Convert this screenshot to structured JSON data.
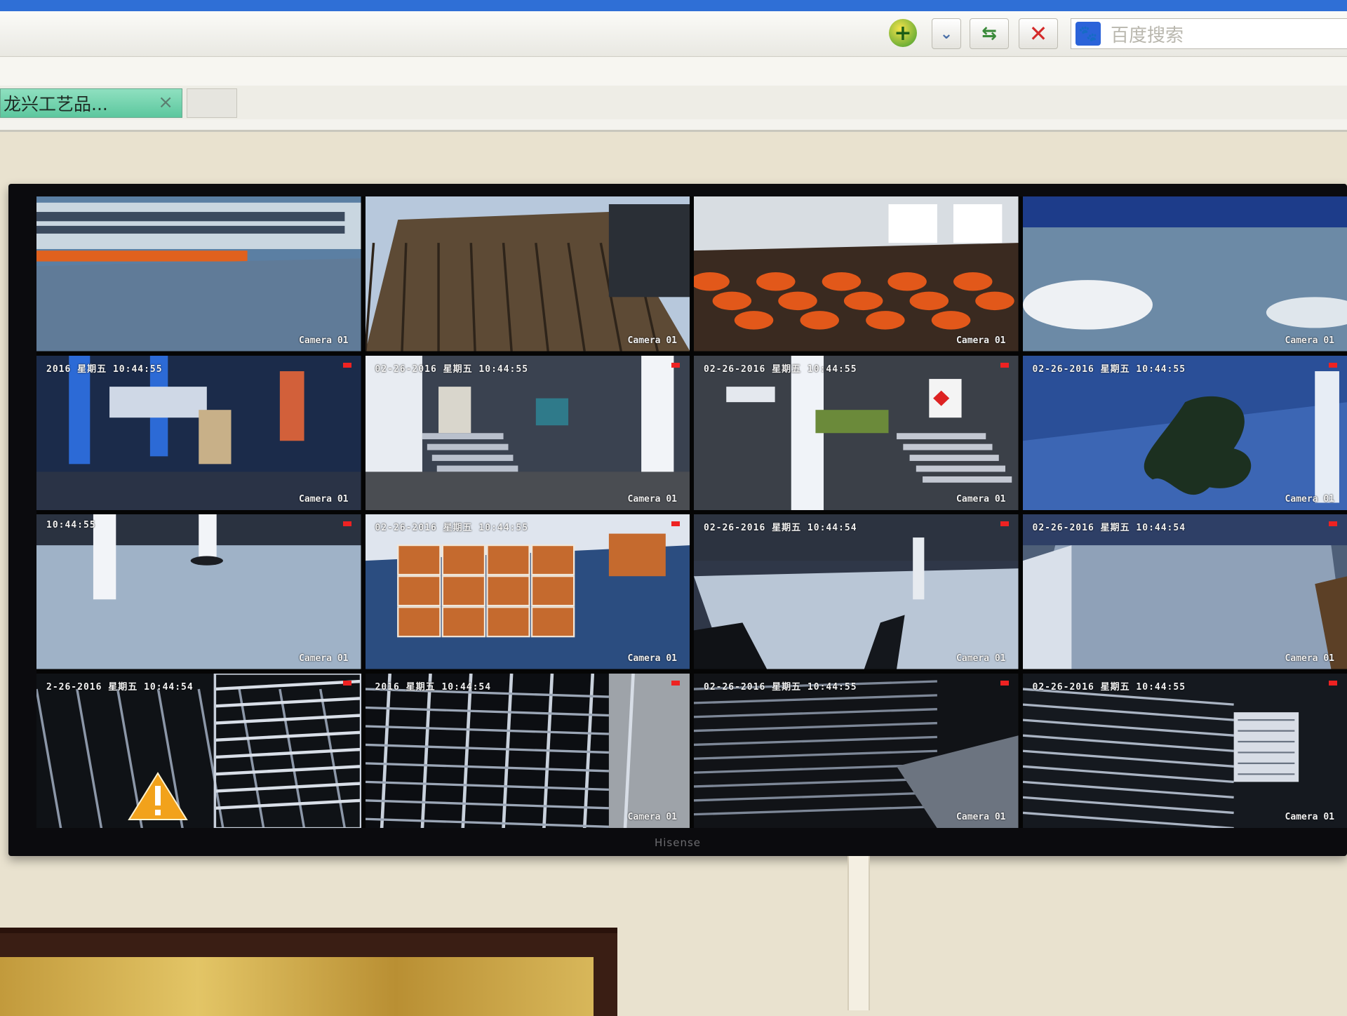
{
  "browser": {
    "search_placeholder": "百度搜索",
    "active_tab_label": "龙兴工艺品...",
    "tab_close_glyph": "×",
    "add_icon_glyph": "+",
    "dropdown_glyph": "⌄",
    "refresh_glyph": "⇆",
    "stop_glyph": "✕",
    "baidu_glyph": "🐾"
  },
  "monitor": {
    "brand": "Hisense",
    "tiles": [
      {
        "timestamp": "",
        "camera": "Camera 01",
        "scene": "yard"
      },
      {
        "timestamp": "",
        "camera": "Camera 01",
        "scene": "wood"
      },
      {
        "timestamp": "",
        "camera": "Camera 01",
        "scene": "hall-orange"
      },
      {
        "timestamp": "",
        "camera": "Camera 01",
        "scene": "parking"
      },
      {
        "timestamp": "2016 星期五 10:44:55",
        "camera": "Camera 01",
        "scene": "machine"
      },
      {
        "timestamp": "02-26-2016 星期五 10:44:55",
        "camera": "Camera 01",
        "scene": "stairs"
      },
      {
        "timestamp": "02-26-2016 星期五 10:44:55",
        "camera": "Camera 01",
        "scene": "stairs2"
      },
      {
        "timestamp": "02-26-2016 星期五 10:44:55",
        "camera": "Camera 01",
        "scene": "blue-tree"
      },
      {
        "timestamp": "10:44:55",
        "camera": "Camera 01",
        "scene": "floor"
      },
      {
        "timestamp": "02-26-2016 星期五 10:44:55",
        "camera": "Camera 01",
        "scene": "boxes"
      },
      {
        "timestamp": "02-26-2016 星期五 10:44:54",
        "camera": "Camera 01",
        "scene": "warehouse"
      },
      {
        "timestamp": "02-26-2016 星期五 10:44:54",
        "camera": "Camera 01",
        "scene": "ramp"
      },
      {
        "timestamp": "2-26-2016 星期五 10:44:54",
        "camera": "",
        "scene": "racks-warning"
      },
      {
        "timestamp": "2016 星期五 10:44:54",
        "camera": "Camera 01",
        "scene": "racks"
      },
      {
        "timestamp": "02-26-2016 星期五 10:44:55",
        "camera": "Camera 01",
        "scene": "racks-dark"
      },
      {
        "timestamp": "02-26-2016 星期五 10:44:55",
        "camera": "Camera 01",
        "scene": "racks-right"
      }
    ]
  },
  "colors": {
    "wall": "#e9e2cf",
    "tab_active": "#5cc79e",
    "rec_indicator": "#e22222",
    "warning": "#f2a21b"
  }
}
